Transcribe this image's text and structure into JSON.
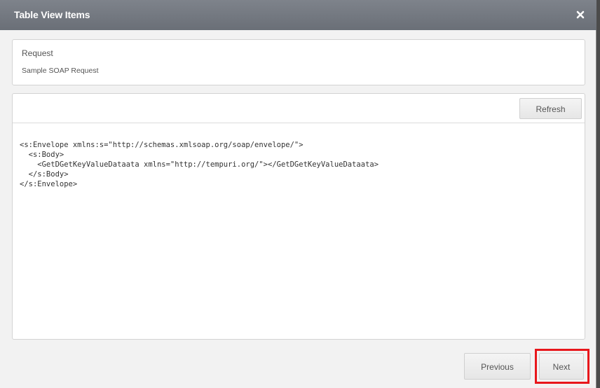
{
  "dialog": {
    "title": "Table View Items"
  },
  "request": {
    "title": "Request",
    "subtitle": "Sample SOAP Request"
  },
  "editor": {
    "refresh_label": "Refresh",
    "code_lines": [
      "<s:Envelope xmlns:s=\"http://schemas.xmlsoap.org/soap/envelope/\">",
      "  <s:Body>",
      "    <GetDGetKeyValueDataata xmlns=\"http://tempuri.org/\"></GetDGetKeyValueDataata>",
      "  </s:Body>",
      "</s:Envelope>"
    ]
  },
  "footer": {
    "previous_label": "Previous",
    "next_label": "Next"
  },
  "colors": {
    "header": "#72777f",
    "highlight": "#e8171c"
  },
  "icons": {
    "close": "close-icon"
  }
}
